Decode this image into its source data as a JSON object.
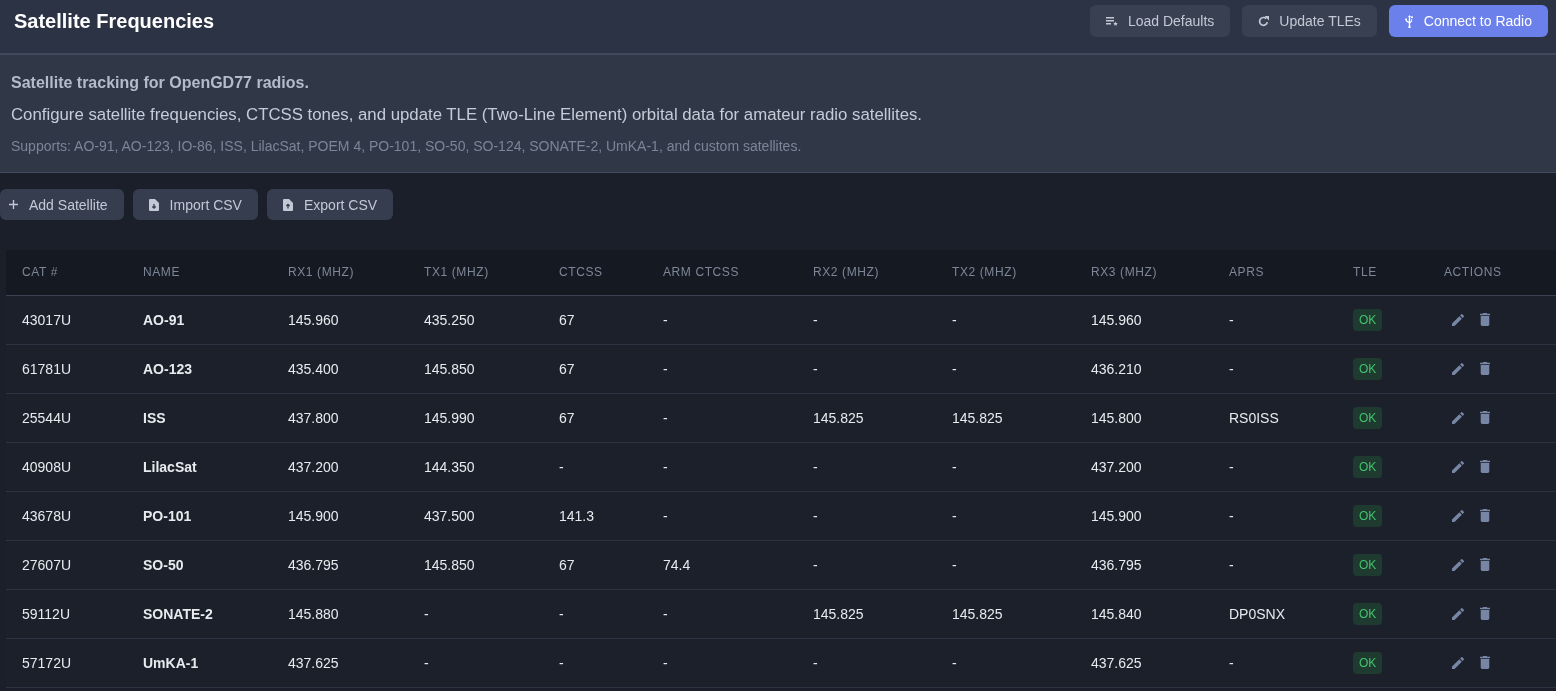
{
  "header": {
    "title": "Satellite Frequencies",
    "actions": [
      {
        "label": "Load Defaults",
        "kind": "secondary"
      },
      {
        "label": "Update TLEs",
        "kind": "secondary"
      },
      {
        "label": "Connect to Radio",
        "kind": "primary"
      }
    ]
  },
  "intro": {
    "heading": "Satellite tracking for OpenGD77 radios.",
    "description": "Configure satellite frequencies, CTCSS tones, and update TLE (Two-Line Element) orbital data for amateur radio satellites.",
    "supports": "Supports: AO-91, AO-123, IO-86, ISS, LilacSat, POEM 4, PO-101, SO-50, SO-124, SONATE-2, UmKA-1, and custom satellites."
  },
  "toolbar": [
    {
      "label": "Add Satellite"
    },
    {
      "label": "Import CSV"
    },
    {
      "label": "Export CSV"
    }
  ],
  "table": {
    "columns": [
      "CAT #",
      "NAME",
      "RX1 (MHZ)",
      "TX1 (MHZ)",
      "CTCSS",
      "ARM CTCSS",
      "RX2 (MHZ)",
      "TX2 (MHZ)",
      "RX3 (MHZ)",
      "APRS",
      "TLE",
      "ACTIONS"
    ],
    "rows": [
      {
        "cells": [
          "43017U",
          "AO-91",
          "145.960",
          "435.250",
          "67",
          "-",
          "-",
          "-",
          "145.960",
          "-"
        ],
        "tle": "OK",
        "tle_valid": true
      },
      {
        "cells": [
          "61781U",
          "AO-123",
          "435.400",
          "145.850",
          "67",
          "-",
          "-",
          "-",
          "436.210",
          "-"
        ],
        "tle": "OK",
        "tle_valid": true
      },
      {
        "cells": [
          "25544U",
          "ISS",
          "437.800",
          "145.990",
          "67",
          "-",
          "145.825",
          "145.825",
          "145.800",
          "RS0ISS"
        ],
        "tle": "OK",
        "tle_valid": true
      },
      {
        "cells": [
          "40908U",
          "LilacSat",
          "437.200",
          "144.350",
          "-",
          "-",
          "-",
          "-",
          "437.200",
          "-"
        ],
        "tle": "OK",
        "tle_valid": true
      },
      {
        "cells": [
          "43678U",
          "PO-101",
          "145.900",
          "437.500",
          "141.3",
          "-",
          "-",
          "-",
          "145.900",
          "-"
        ],
        "tle": "OK",
        "tle_valid": true
      },
      {
        "cells": [
          "27607U",
          "SO-50",
          "436.795",
          "145.850",
          "67",
          "74.4",
          "-",
          "-",
          "436.795",
          "-"
        ],
        "tle": "OK",
        "tle_valid": true
      },
      {
        "cells": [
          "59112U",
          "SONATE-2",
          "145.880",
          "-",
          "-",
          "-",
          "145.825",
          "145.825",
          "145.840",
          "DP0SNX"
        ],
        "tle": "OK",
        "tle_valid": true
      },
      {
        "cells": [
          "57172U",
          "UmKA-1",
          "437.625",
          "-",
          "-",
          "-",
          "-",
          "-",
          "437.625",
          "-"
        ],
        "tle": "OK",
        "tle_valid": true
      }
    ]
  }
}
